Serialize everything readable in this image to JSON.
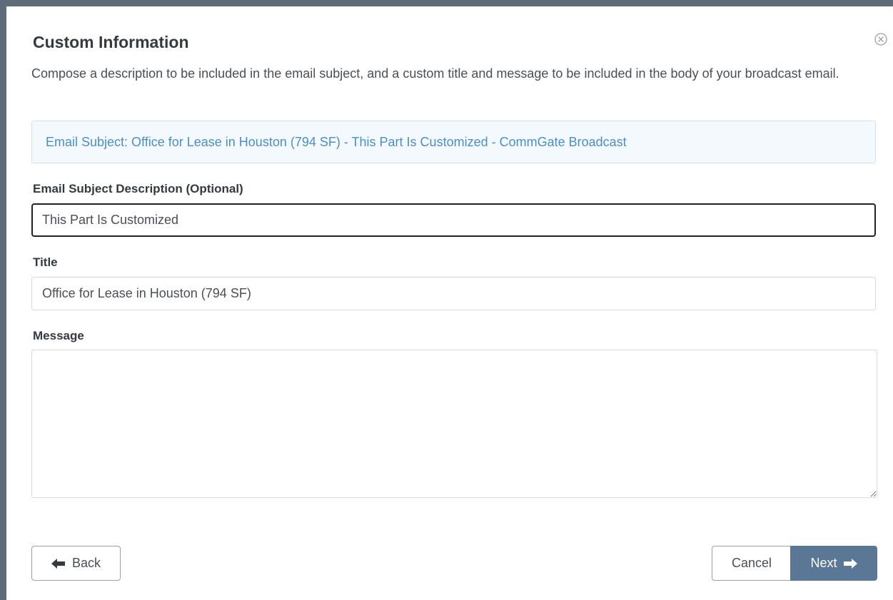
{
  "modal": {
    "title": "Custom Information",
    "description": "Compose a description to be included in the email subject, and a custom title and message to be included in the body of your broadcast email.",
    "close_icon": "close-circle-icon"
  },
  "subject_preview": {
    "text": "Email Subject: Office for Lease in Houston (794 SF) - This Part Is Customized - CommGate Broadcast"
  },
  "fields": {
    "subject_description": {
      "label": "Email Subject Description (Optional)",
      "value": "This Part Is Customized"
    },
    "title": {
      "label": "Title",
      "value": "Office for Lease in Houston (794 SF)"
    },
    "message": {
      "label": "Message",
      "value": ""
    }
  },
  "buttons": {
    "back": {
      "label": "Back",
      "icon": "arrow-left-icon"
    },
    "cancel": {
      "label": "Cancel"
    },
    "next": {
      "label": "Next",
      "icon": "arrow-right-icon"
    }
  },
  "colors": {
    "accent": "#5a7896",
    "subject_text": "#4a8fcb",
    "subject_bg": "#f4f9fd",
    "backdrop": "#5f6b78"
  }
}
